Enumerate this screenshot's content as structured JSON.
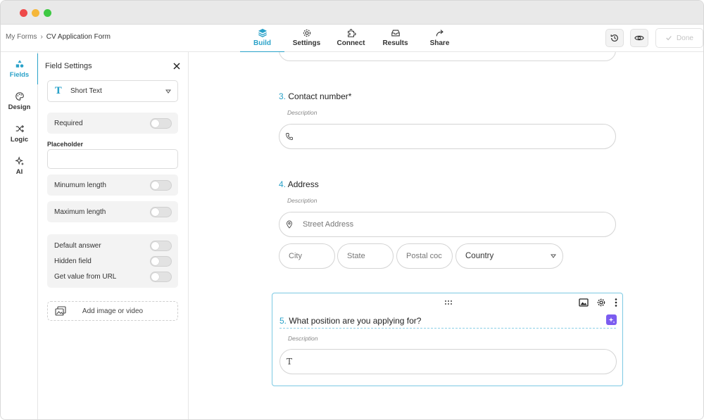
{
  "breadcrumb": {
    "root": "My Forms",
    "separator": "›",
    "current": "CV Application Form"
  },
  "nav_tabs": [
    {
      "label": "Build",
      "icon": "layers-icon",
      "active": true
    },
    {
      "label": "Settings",
      "icon": "gear-icon"
    },
    {
      "label": "Connect",
      "icon": "puzzle-icon"
    },
    {
      "label": "Results",
      "icon": "inbox-icon"
    },
    {
      "label": "Share",
      "icon": "share-arrow-icon"
    }
  ],
  "header": {
    "done_label": "Done",
    "history_icon": "history-icon",
    "preview_icon": "eye-icon"
  },
  "rail": [
    {
      "label": "Fields",
      "icon": "shapes-icon",
      "active": true
    },
    {
      "label": "Design",
      "icon": "palette-icon"
    },
    {
      "label": "Logic",
      "icon": "shuffle-icon"
    },
    {
      "label": "AI",
      "icon": "sparkles-icon"
    }
  ],
  "panel": {
    "title": "Field Settings",
    "field_type": {
      "glyph": "T",
      "label": "Short Text"
    },
    "required_label": "Required",
    "placeholder_label": "Placeholder",
    "placeholder_value": "",
    "min_length_label": "Minumum length",
    "max_length_label": "Maximum length",
    "default_answer_label": "Default answer",
    "hidden_field_label": "Hidden field",
    "get_value_label": "Get value from URL",
    "add_media_label": "Add image or video"
  },
  "questions": [
    {
      "number": "3.",
      "title": "Contact number*",
      "description": "Description",
      "icon": "phone-icon"
    },
    {
      "number": "4.",
      "title": "Address",
      "description": "Description",
      "street_placeholder": "Street Address",
      "city_placeholder": "City",
      "state_placeholder": "State",
      "postal_placeholder": "Postal coc",
      "country_label": "Country"
    },
    {
      "number": "5.",
      "title": "What position are you applying for?",
      "description": "Description",
      "icon_glyph": "T"
    }
  ],
  "colors": {
    "accent": "#2aa2c9",
    "ai_badge": "#7b5cf0",
    "selection_border": "#7cc9e3"
  }
}
